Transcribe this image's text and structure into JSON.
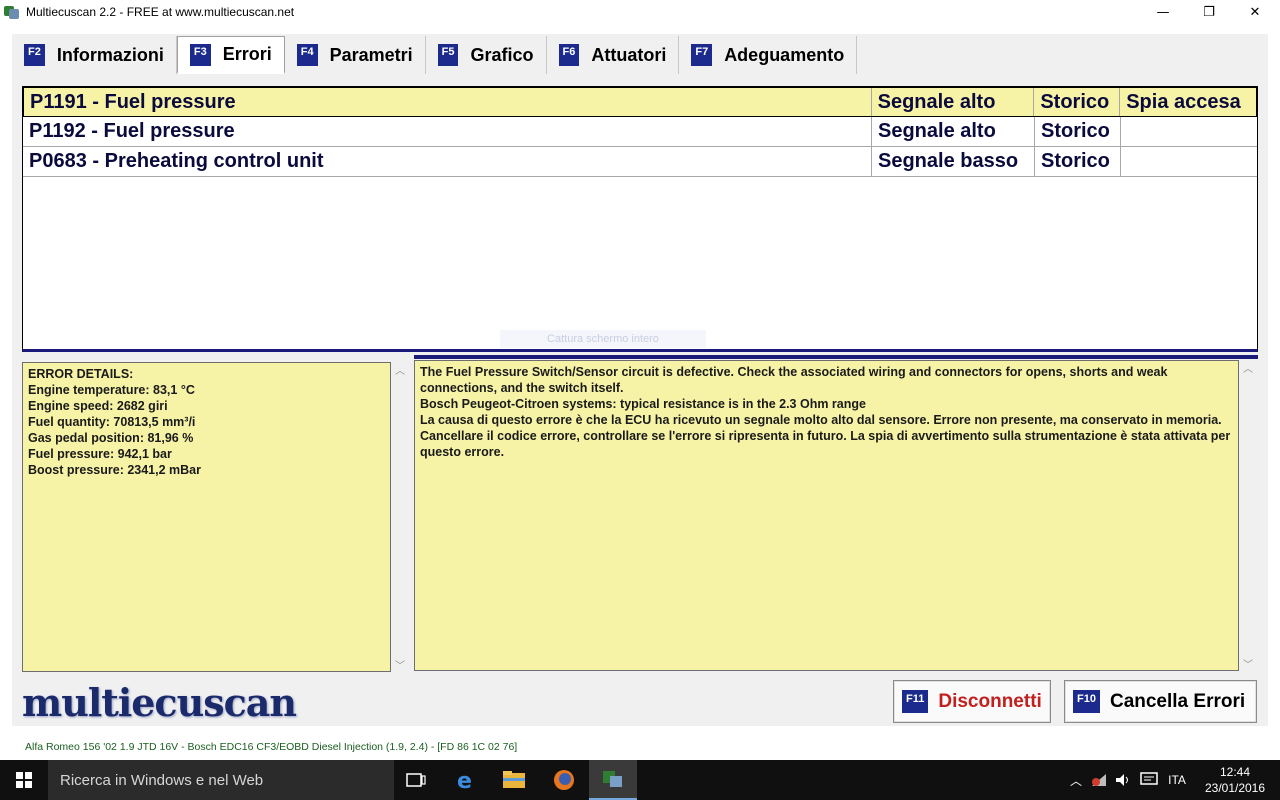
{
  "window": {
    "title": "Multiecuscan 2.2 - FREE at www.multiecuscan.net",
    "minimize_glyph": "—",
    "maximize_glyph": "❐",
    "close_glyph": "✕"
  },
  "tabs": [
    {
      "key": "F2",
      "label": "Informazioni"
    },
    {
      "key": "F3",
      "label": "Errori",
      "active": true
    },
    {
      "key": "F4",
      "label": "Parametri"
    },
    {
      "key": "F5",
      "label": "Grafico"
    },
    {
      "key": "F6",
      "label": "Attuatori"
    },
    {
      "key": "F7",
      "label": "Adeguamento"
    }
  ],
  "errors": [
    {
      "code": "P1191 - Fuel pressure",
      "signal": "Segnale alto",
      "status": "Storico",
      "lamp": "Spia accesa",
      "selected": true
    },
    {
      "code": "P1192 - Fuel pressure",
      "signal": "Segnale alto",
      "status": "Storico",
      "lamp": ""
    },
    {
      "code": "P0683 - Preheating control unit",
      "signal": "Segnale basso",
      "status": "Storico",
      "lamp": ""
    }
  ],
  "capture_hint": "Cattura schermo intero",
  "details": {
    "lines": [
      "ERROR DETAILS:",
      "Engine temperature: 83,1 °C",
      "Engine speed: 2682 giri",
      "Fuel quantity: 70813,5 mm³/i",
      "Gas pedal position: 81,96 %",
      "Fuel pressure: 942,1 bar",
      "Boost pressure: 2341,2 mBar"
    ]
  },
  "description": {
    "paragraphs": [
      "The Fuel Pressure Switch/Sensor circuit is defective. Check the associated wiring and connectors for opens, shorts and weak connections, and the switch itself.",
      "Bosch Peugeot-Citroen systems: typical resistance is in the 2.3 Ohm range",
      "La causa di questo errore è che la ECU ha ricevuto un segnale molto alto dal sensore. Errore non presente, ma conservato in memoria. Cancellare il codice errore, controllare se l'errore si ripresenta in futuro. La spia di avvertimento sulla strumentazione è stata attivata per questo errore."
    ]
  },
  "logo_text": "multiecuscan",
  "buttons": {
    "disconnect": {
      "key": "F11",
      "label": "Disconnetti",
      "color": "#c0201e"
    },
    "clear": {
      "key": "F10",
      "label": "Cancella Errori",
      "color": "#000000"
    }
  },
  "status_text": "Alfa Romeo 156 '02 1.9 JTD 16V - Bosch EDC16 CF3/EOBD Diesel Injection (1.9, 2.4) - [FD 86 1C 02 76]",
  "taskbar": {
    "search_placeholder": "Ricerca in Windows e nel Web",
    "pinned": [
      "task-view-icon",
      "edge-icon",
      "file-explorer-icon",
      "firefox-icon",
      "multiecuscan-icon"
    ],
    "language": "ITA",
    "time": "12:44",
    "date": "23/01/2016"
  },
  "colors": {
    "accent": "#1b2a8c",
    "row_highlight": "#f7f3a6",
    "pane_background": "#f7f3a6"
  }
}
